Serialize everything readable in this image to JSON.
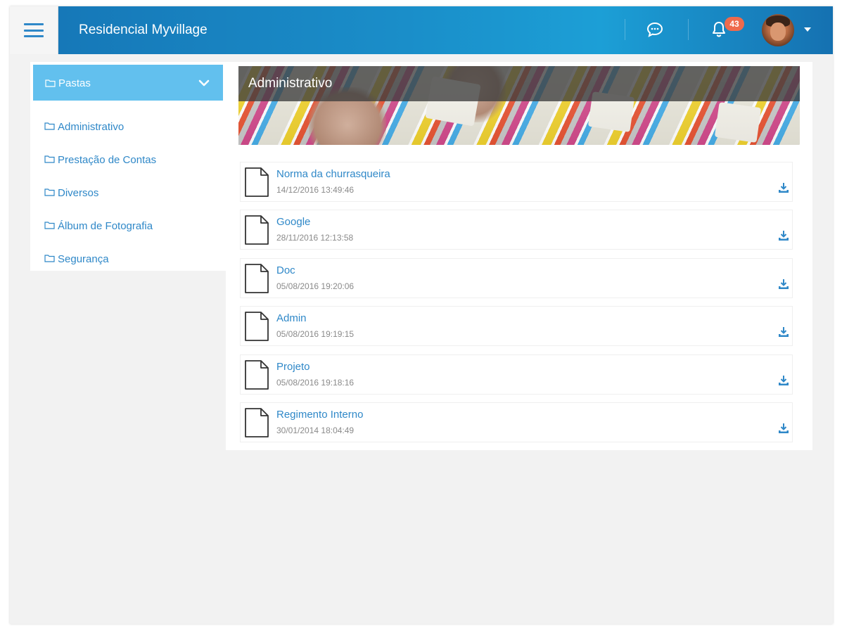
{
  "header": {
    "app_title": "Residencial Myvillage",
    "notification_count": "43",
    "colors": {
      "header": "#1a8ec9",
      "accent": "#62c0ee",
      "link": "#2f88c8",
      "badge": "#ef6a4c"
    }
  },
  "sidebar": {
    "heading": "Pastas",
    "items": [
      {
        "label": "Administrativo"
      },
      {
        "label": "Prestação de Contas"
      },
      {
        "label": "Diversos"
      },
      {
        "label": "Álbum de Fotografia"
      },
      {
        "label": "Segurança"
      }
    ]
  },
  "main": {
    "folder_title": "Administrativo",
    "files": [
      {
        "name": "Norma da churrasqueira",
        "date": "14/12/2016 13:49:46"
      },
      {
        "name": "Google",
        "date": "28/11/2016 12:13:58"
      },
      {
        "name": "Doc",
        "date": "05/08/2016 19:20:06"
      },
      {
        "name": "Admin",
        "date": "05/08/2016 19:19:15"
      },
      {
        "name": "Projeto",
        "date": "05/08/2016 19:18:16"
      },
      {
        "name": "Regimento Interno",
        "date": "30/01/2014 18:04:49"
      }
    ]
  }
}
